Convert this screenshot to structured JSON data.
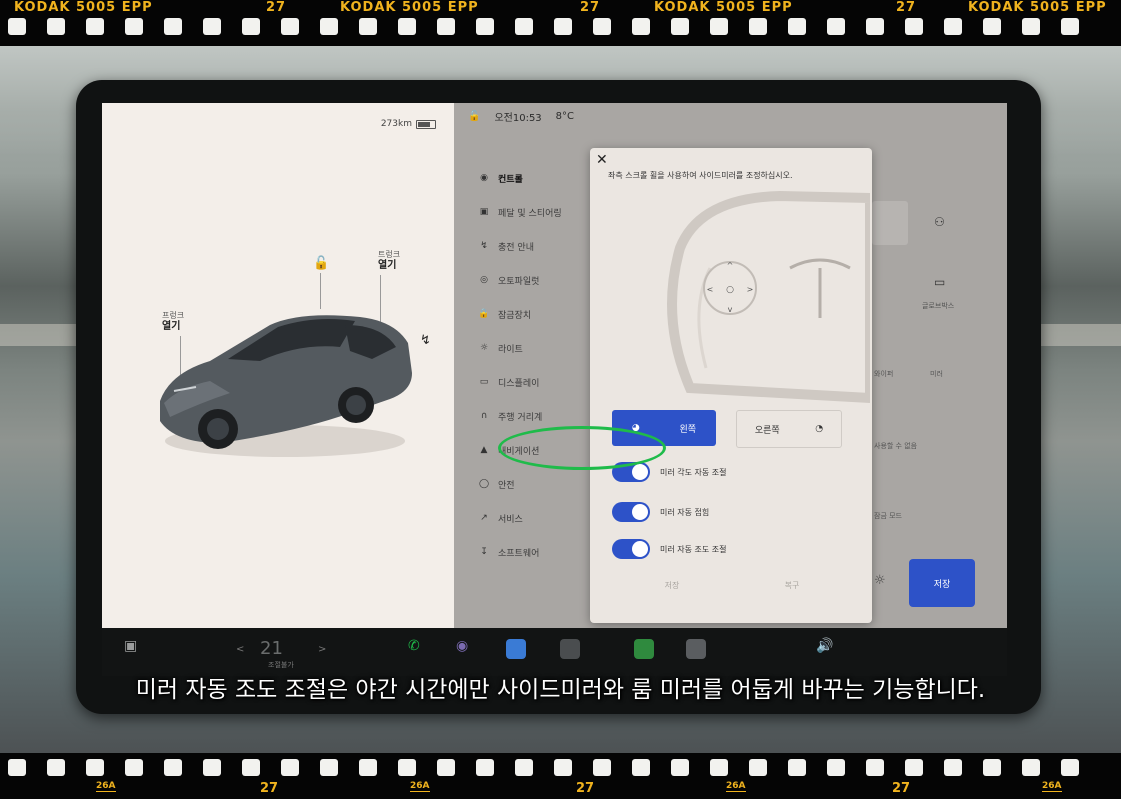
{
  "film": {
    "top_labels": [
      "KODAK 5005 EPP",
      "27",
      "KODAK 5005 EPP",
      "27",
      "KODAK 5005 EPP",
      "27",
      "KODAK 5005 EPP"
    ],
    "bottom_labels": [
      "26A",
      "27",
      "26A",
      "27",
      "26A",
      "27",
      "26A"
    ]
  },
  "left_panel": {
    "range": "273km",
    "trunk_label": "트렁크",
    "trunk_action": "열기",
    "frunk_label": "프렁크",
    "frunk_action": "열기"
  },
  "status_bar": {
    "time": "오전10:53",
    "temperature": "8°C"
  },
  "menu": {
    "items": [
      {
        "label": "컨트롤",
        "icon": "toggle-icon"
      },
      {
        "label": "페달 및 스티어링",
        "icon": "car-icon"
      },
      {
        "label": "충전 안내",
        "icon": "bolt-icon"
      },
      {
        "label": "오토파일럿",
        "icon": "steering-wheel-icon"
      },
      {
        "label": "잠금장치",
        "icon": "lock-icon"
      },
      {
        "label": "라이트",
        "icon": "light-icon"
      },
      {
        "label": "디스플레이",
        "icon": "display-icon"
      },
      {
        "label": "주행 거리계",
        "icon": "odometer-icon"
      },
      {
        "label": "내비게이션",
        "icon": "navigation-icon"
      },
      {
        "label": "안전",
        "icon": "safety-icon"
      },
      {
        "label": "서비스",
        "icon": "wrench-icon"
      },
      {
        "label": "소프트웨어",
        "icon": "download-icon"
      }
    ]
  },
  "quick_controls": {
    "glovebox_label": "글로브박스",
    "label_2": "와이퍼",
    "label_3": "사용할 수 없음",
    "label_4": "잠금 모드",
    "label_5": "미러",
    "save_label": "저장"
  },
  "mirror_modal": {
    "instruction": "좌측 스크롤 휠을 사용하여 사이드미러를 조정하십시오.",
    "left_label": "왼쪽",
    "right_label": "오른쪽",
    "toggles": [
      {
        "label": "미러 각도 자동 조절",
        "on": true
      },
      {
        "label": "미러 자동 접힘",
        "on": true
      },
      {
        "label": "미러 자동 조도 조절",
        "on": true
      }
    ],
    "footer_left": "저장",
    "footer_right": "복구"
  },
  "taskbar": {
    "temperature": "21",
    "temp_unit": "조절불가"
  },
  "subtitle": "미러 자동 조도 조절은 야간 시간에만 사이드미러와 룸 미러를 어둡게 바꾸는 기능합니다.",
  "colors": {
    "accent": "#2d52c8",
    "highlight_ring": "#1fbb4a",
    "film_text": "#f0b31e"
  }
}
